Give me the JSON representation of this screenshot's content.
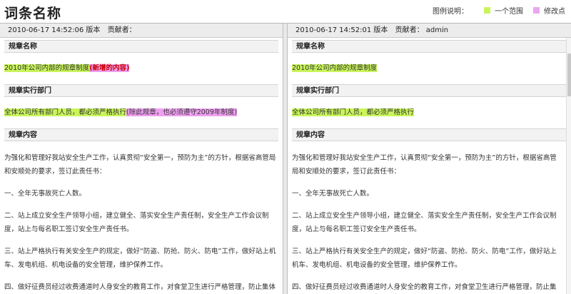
{
  "page": {
    "title": "词条名称"
  },
  "legend": {
    "label": "图例说明：",
    "items": [
      {
        "name": "一个范围",
        "color": "#c9f55b"
      },
      {
        "name": "修改点",
        "color": "#e9a7ef"
      }
    ]
  },
  "left": {
    "version_time": "2010-06-17 14:52:06",
    "version_label": "版本",
    "contributor_label": "贡献者：",
    "contributor": "",
    "sections": [
      {
        "heading": "规章名称",
        "scope_text": "2010年公司内部的规章制度",
        "mod_text": "(新增的内容)"
      },
      {
        "heading": "规章实行部门",
        "scope_text": "全体公司所有部门人员，都必须严格执行",
        "mod_text": "(除此规章，也必须遵守2009年制度)"
      },
      {
        "heading": "规章内容",
        "paragraphs": [
          "为强化和管理好我站安全生产工作，认真贯彻“安全第一，预防为主”的方针，根据省高管局和安顺处的要求，签订此责任书：",
          "一、全年无事故死亡人数。",
          "二、站上成立安全生产领导小组，建立健全、落实安全生产责任制，安全生产工作会议制度，站上与每名职工签订安全生产责任书。",
          "三、站上严格执行有关安全生产的规定，做好“防盗、防抢、防火、防电”工作，做好站上机车、发电机组、机电设备的安全管理，维护保养工作。",
          "四、做好征费员经过收费通道时人身安全的教育工作，对食堂卫生进行严格管理，防止集体中毒或传染病"
        ]
      }
    ]
  },
  "right": {
    "version_time": "2010-06-17 14:52:01",
    "version_label": "版本",
    "contributor_label": "贡献者：",
    "contributor": "admin",
    "sections": [
      {
        "heading": "规章名称",
        "scope_text": "2010年公司内部的规章制度"
      },
      {
        "heading": "规章实行部门",
        "scope_text": "全体公司所有部门人员，都必须严格执行"
      },
      {
        "heading": "规章内容",
        "paragraphs": [
          "为强化和管理好我站安全生产工作，认真贯彻“安全第一，预防为主”的方针，根据省高管局和安顺处的要求，签订此责任书：",
          "一、全年无事故死亡人数。",
          "二、站上成立安全生产领导小组，建立健全、落实安全生产责任制，安全生产工作会议制度，站上与每名职工签订安全生产责任书。",
          "三、站上严格执行有关安全生产的规定，做好“防盗、防抢、防火、防电”工作，做好站上机车、发电机组、机电设备的安全管理，维护保养工作。",
          "四、做好征费员经过收费通道时人身安全的教育工作，对食堂卫生进行严格管理，防止集体中毒或传染病"
        ]
      }
    ]
  }
}
